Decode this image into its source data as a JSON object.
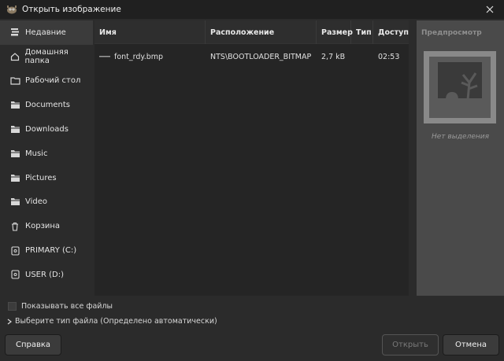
{
  "window": {
    "title": "Открыть изображение",
    "close_icon": "close-icon"
  },
  "sidebar": {
    "items": [
      {
        "label": "Недавние",
        "icon": "recent-icon",
        "active": true
      },
      {
        "label": "Домашняя папка",
        "icon": "home-icon"
      },
      {
        "label": "Рабочий стол",
        "icon": "folder-icon"
      },
      {
        "label": "Documents",
        "icon": "folder-icon"
      },
      {
        "label": "Downloads",
        "icon": "folder-icon"
      },
      {
        "label": "Music",
        "icon": "folder-icon"
      },
      {
        "label": "Pictures",
        "icon": "folder-icon"
      },
      {
        "label": "Video",
        "icon": "folder-icon"
      },
      {
        "label": "Корзина",
        "icon": "trash-icon"
      },
      {
        "label": "PRIMARY (C:)",
        "icon": "drive-icon"
      },
      {
        "label": "USER (D:)",
        "icon": "drive-icon"
      }
    ]
  },
  "filelist": {
    "columns": [
      "Имя",
      "Расположение",
      "Размер",
      "Тип",
      "Доступ"
    ],
    "rows": [
      {
        "name": "font_rdy.bmp",
        "location": "NTS\\BOOTLOADER_BITMAP",
        "size": "2,7 kB",
        "type": "",
        "access": "02:53"
      }
    ]
  },
  "preview": {
    "title": "Предпросмотр",
    "empty_text": "Нет выделения"
  },
  "options": {
    "show_all_label": "Показывать все файлы",
    "show_all_checked": false,
    "filetype_label": "Выберите тип файла (Определено автоматически)"
  },
  "buttons": {
    "help": "Справка",
    "open": "Открыть",
    "cancel": "Отмена"
  }
}
